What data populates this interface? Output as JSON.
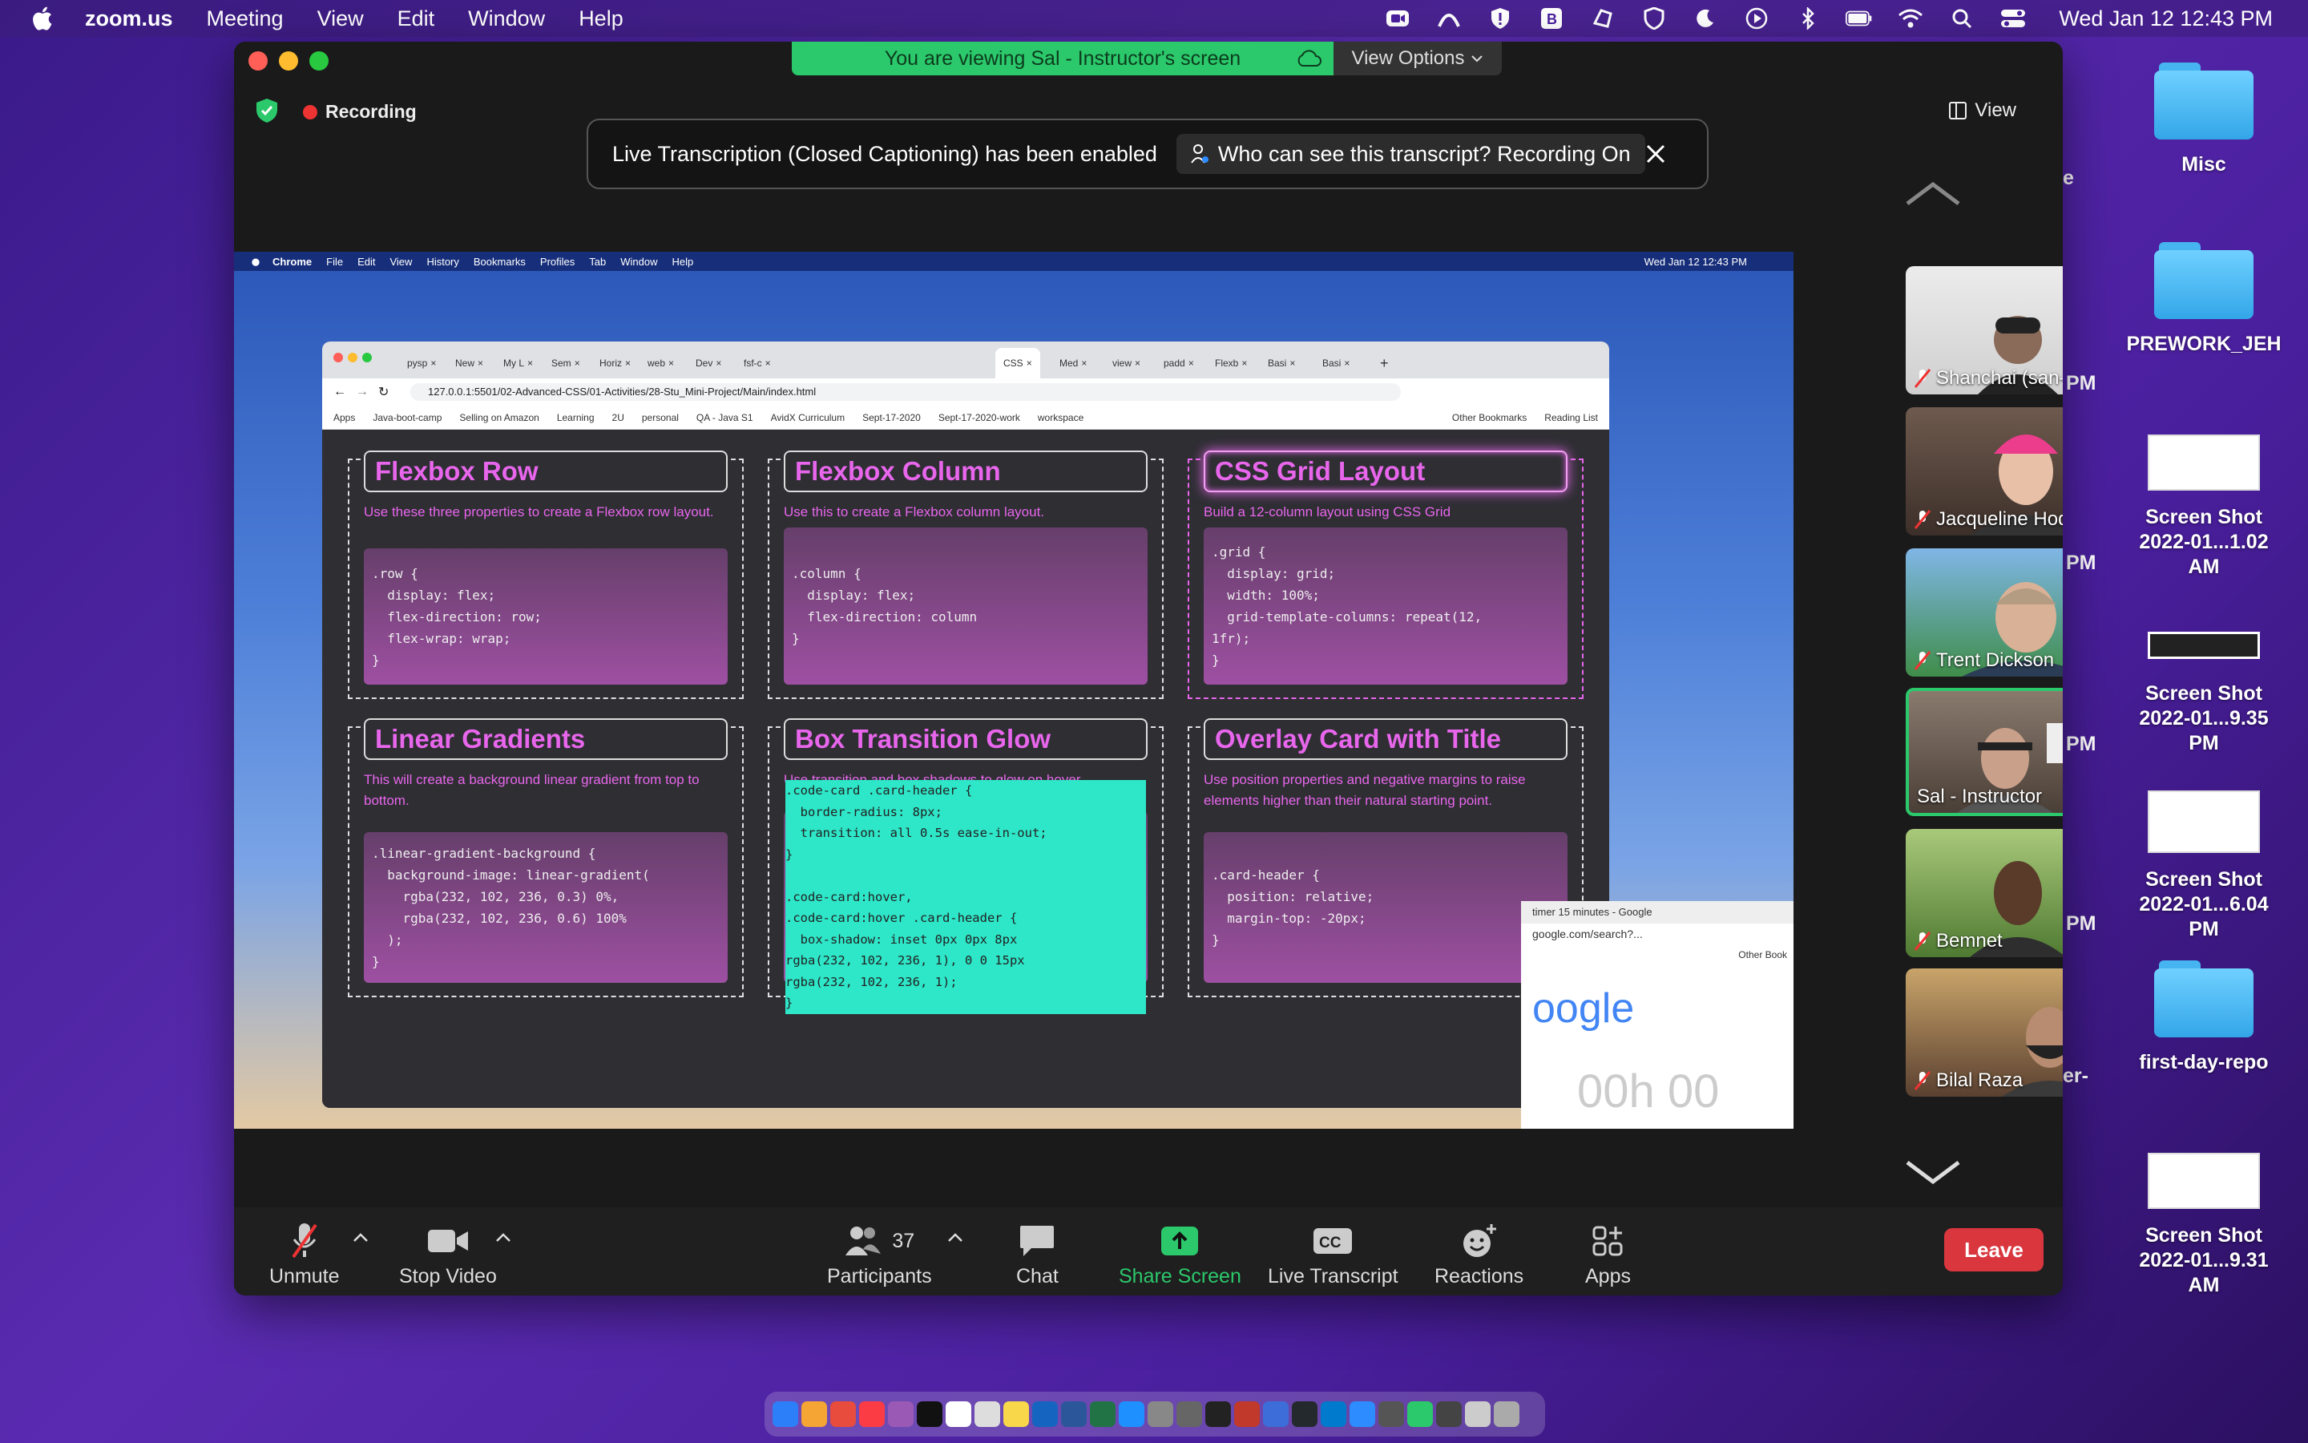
{
  "menubar": {
    "app_name": "zoom.us",
    "menus": [
      "Meeting",
      "View",
      "Edit",
      "Window",
      "Help"
    ],
    "clock": "Wed Jan 12  12:43 PM"
  },
  "desktop": {
    "items": [
      "Misc",
      "PREWORK_JEH",
      "Screen Shot\n2022-01...1.02 AM",
      "Screen Shot\n2022-01...9.35 PM",
      "Screen Shot\n2022-01...6.04 PM",
      "first-day-repo",
      "Screen Shot\n2022-01...9.31 AM"
    ],
    "partial_labels": [
      "e",
      "PM",
      "PM",
      "PM",
      "PM",
      "er-"
    ]
  },
  "zoom": {
    "viewing_banner": "You are viewing Sal - Instructor's screen",
    "view_options": "View Options",
    "recording": "Recording",
    "view_button": "View",
    "notice_text": "Live Transcription (Closed Captioning) has been enabled",
    "notice_who": "Who can see this transcript? Recording On",
    "participants": [
      {
        "name": "Shanchai (san-cho...",
        "muted": true
      },
      {
        "name": "Jacqueline Hodgson",
        "muted": true
      },
      {
        "name": "Trent Dickson",
        "muted": true
      },
      {
        "name": "Sal - Instructor",
        "muted": false
      },
      {
        "name": "Bemnet",
        "muted": true
      },
      {
        "name": "Bilal Raza",
        "muted": true
      }
    ],
    "toolbar": {
      "unmute": "Unmute",
      "stop_video": "Stop Video",
      "participants": "Participants",
      "participant_count": "37",
      "chat": "Chat",
      "share_screen": "Share Screen",
      "live_transcript": "Live Transcript",
      "reactions": "Reactions",
      "apps": "Apps",
      "leave": "Leave"
    }
  },
  "shared": {
    "mini_menubar": [
      "Chrome",
      "File",
      "Edit",
      "View",
      "History",
      "Bookmarks",
      "Profiles",
      "Tab",
      "Window",
      "Help"
    ],
    "mini_clock": "Wed Jan 12  12:43 PM",
    "tabs": [
      "pysp",
      "New",
      "My L",
      "Sem",
      "Horiz",
      "web",
      "Dev",
      "fsf-c",
      "CSS",
      "Med",
      "view",
      "padd",
      "Flexb",
      "Basi",
      "Basi"
    ],
    "url": "127.0.0.1:5501/02-Advanced-CSS/01-Activities/28-Stu_Mini-Project/Main/index.html",
    "bookmarks": [
      "Apps",
      "Java-boot-camp",
      "Selling on Amazon",
      "Learning",
      "2U",
      "personal",
      "QA - Java S1",
      "AvidX Curriculum",
      "Sept-17-2020",
      "Sept-17-2020-work",
      "workspace",
      "Other Bookmarks",
      "Reading List"
    ],
    "cards": [
      {
        "title": "Flexbox Row",
        "desc": "Use these three properties to create a Flexbox row layout.",
        "code": ".row {\n  display: flex;\n  flex-direction: row;\n  flex-wrap: wrap;\n}"
      },
      {
        "title": "Flexbox Column",
        "desc": "Use this to create a Flexbox column layout.",
        "code": ".column {\n  display: flex;\n  flex-direction: column\n}"
      },
      {
        "title": "CSS Grid Layout",
        "desc": "Build a 12-column layout using CSS Grid",
        "code": ".grid {\n  display: grid;\n  width: 100%;\n  grid-template-columns: repeat(12,\n1fr);\n}"
      },
      {
        "title": "Linear Gradients",
        "desc": "This will create a background linear gradient from top to bottom.",
        "code": ".linear-gradient-background {\n  background-image: linear-gradient(\n    rgba(232, 102, 236, 0.3) 0%,\n    rgba(232, 102, 236, 0.6) 100%\n  );\n}"
      },
      {
        "title": "Box Transition Glow",
        "desc": "Use transition and box shadows to glow on hover.",
        "code": ".code-card .card-header {\n  border-radius: 8px;\n  transition: all 0.5s ease-in-out;\n}\n\n.code-card:hover,\n.code-card:hover .card-header {\n  box-shadow: inset 0px 0px 8px\nrgba(232, 102, 236, 1), 0 0 15px\nrgba(232, 102, 236, 1);\n}"
      },
      {
        "title": "Overlay Card with Title",
        "desc": "Use position properties and negative margins to raise elements higher than their natural starting point.",
        "code": ".card-header {\n  position: relative;\n  margin-top: -20px;\n}"
      }
    ],
    "google_tab": "timer 15 minutes - Google",
    "google_url": "google.com/search?...",
    "google_bookmark": "Other Book",
    "google_logo": "oogle",
    "google_timer": "00h  00"
  },
  "colors": {
    "accent": "#e866ec",
    "zoom_green": "#2bc96b",
    "leave_red": "#d9363e"
  }
}
